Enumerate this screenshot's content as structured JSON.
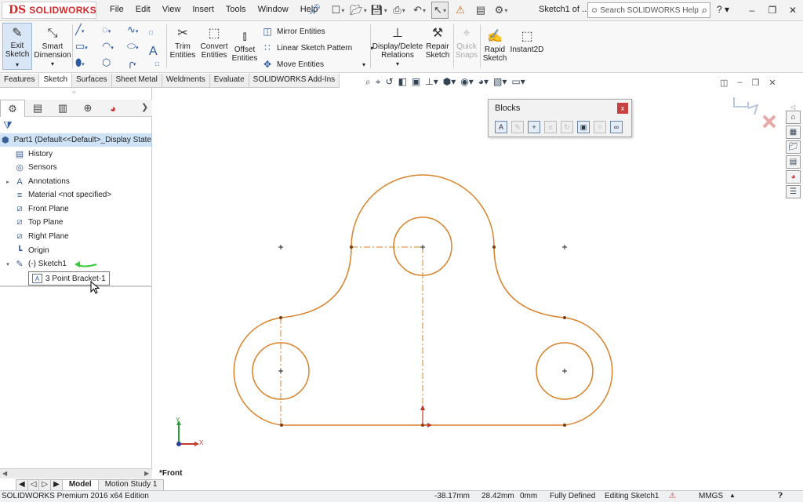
{
  "app": {
    "brand_ds": "DS",
    "brand_name": "SOLIDWORKS",
    "doc_title": "Sketch1 of ...",
    "help_placeholder": "Search SOLIDWORKS Help",
    "help_q": "?"
  },
  "menu": [
    "File",
    "Edit",
    "View",
    "Insert",
    "Tools",
    "Window",
    "Help"
  ],
  "ribbon": {
    "exit_sketch": "Exit\nSketch",
    "smart_dimension": "Smart\nDimension",
    "trim_entities": "Trim\nEntities",
    "convert_entities": "Convert\nEntities",
    "offset_entities": "Offset\nEntities",
    "mirror_entities": "Mirror Entities",
    "linear_sketch_pattern": "Linear Sketch Pattern",
    "move_entities": "Move Entities",
    "display_delete_relations": "Display/Delete\nRelations",
    "repair_sketch": "Repair\nSketch",
    "quick_snaps": "Quick\nSnaps",
    "rapid_sketch": "Rapid\nSketch",
    "instant2d": "Instant2D"
  },
  "cm_tabs": [
    "Features",
    "Sketch",
    "Surfaces",
    "Sheet Metal",
    "Weldments",
    "Evaluate",
    "SOLIDWORKS Add-Ins"
  ],
  "cm_tabs_active": "Sketch",
  "feature_tree": {
    "part": "Part1  (Default<<Default>_Display State",
    "items": [
      {
        "label": "History"
      },
      {
        "label": "Sensors"
      },
      {
        "label": "Annotations"
      },
      {
        "label": "Material <not specified>"
      },
      {
        "label": "Front Plane"
      },
      {
        "label": "Top Plane"
      },
      {
        "label": "Right Plane"
      },
      {
        "label": "Origin"
      },
      {
        "label": "(-) Sketch1"
      }
    ],
    "block_instance": "3 Point Bracket-1"
  },
  "blocks_toolbar": {
    "title": "Blocks",
    "close": "x"
  },
  "bottom_tabs": [
    "Model",
    "Motion Study 1"
  ],
  "view_name": "*Front",
  "triad": {
    "x": "X",
    "y": "Y"
  },
  "status": {
    "edition": "SOLIDWORKS Premium 2016 x64 Edition",
    "x": "-38.17mm",
    "y": "28.42mm",
    "z": "0mm",
    "state": "Fully Defined",
    "editing": "Editing Sketch1",
    "units": "MMGS"
  },
  "colors": {
    "sketch": "#d9822b",
    "centerline": "#d9822b",
    "tree_selection": "#cfe3f7",
    "brand": "#d02a2a"
  }
}
